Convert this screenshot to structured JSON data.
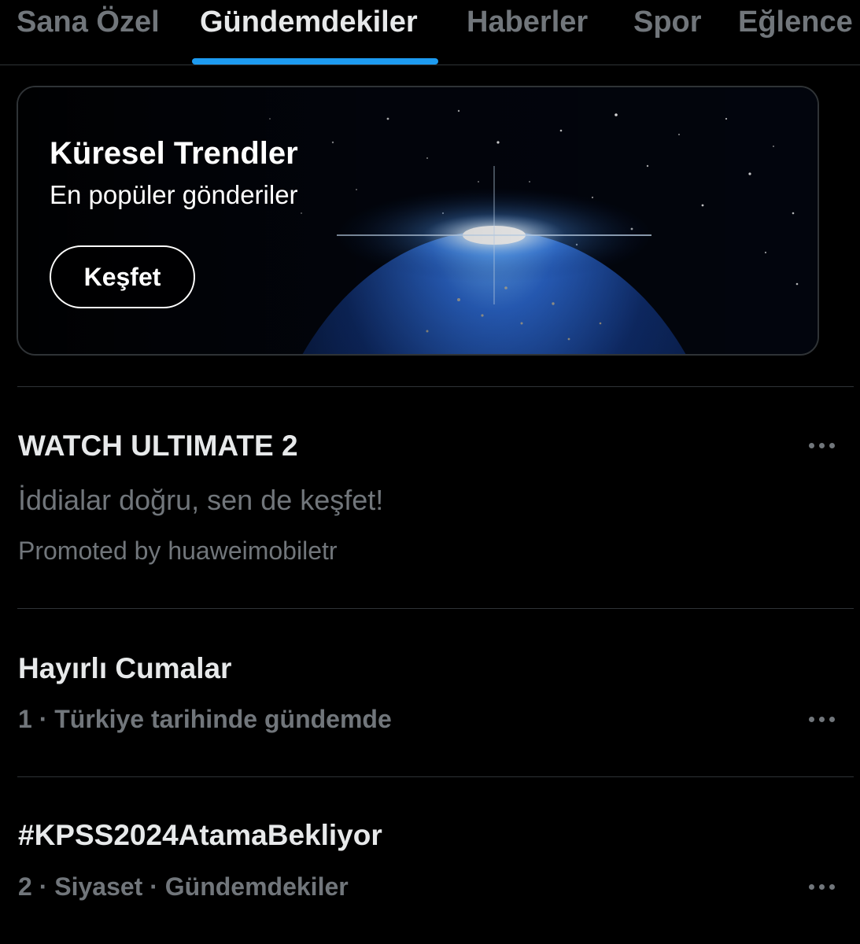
{
  "tabs": [
    {
      "label": "Sana Özel"
    },
    {
      "label": "Gündemdekiler"
    },
    {
      "label": "Haberler"
    },
    {
      "label": "Spor"
    },
    {
      "label": "Eğlence"
    }
  ],
  "active_tab_index": 1,
  "colors": {
    "background": "#000000",
    "primary_text": "#e7e9ea",
    "secondary_text": "#71767b",
    "accent": "#1d9bf0",
    "divider": "#2f3336"
  },
  "global_trends_card": {
    "title": "Küresel Trendler",
    "subtitle": "En popüler gönderiler",
    "button_label": "Keşfet",
    "image": "earth-from-space-sunrise"
  },
  "trends": [
    {
      "title": "WATCH ULTIMATE 2",
      "text": "İddialar doğru, sen de keşfet!",
      "meta": "Promoted by huaweimobiletr",
      "promoted": true,
      "more_icon": "ellipsis-icon"
    },
    {
      "title": "Hayırlı Cumalar",
      "meta": "1 · Türkiye tarihinde gündemde",
      "promoted": false,
      "more_icon": "ellipsis-icon"
    },
    {
      "title": "#KPSS2024AtamaBekliyor",
      "meta": "2 · Siyaset · Gündemdekiler",
      "promoted": false,
      "more_icon": "ellipsis-icon"
    }
  ]
}
